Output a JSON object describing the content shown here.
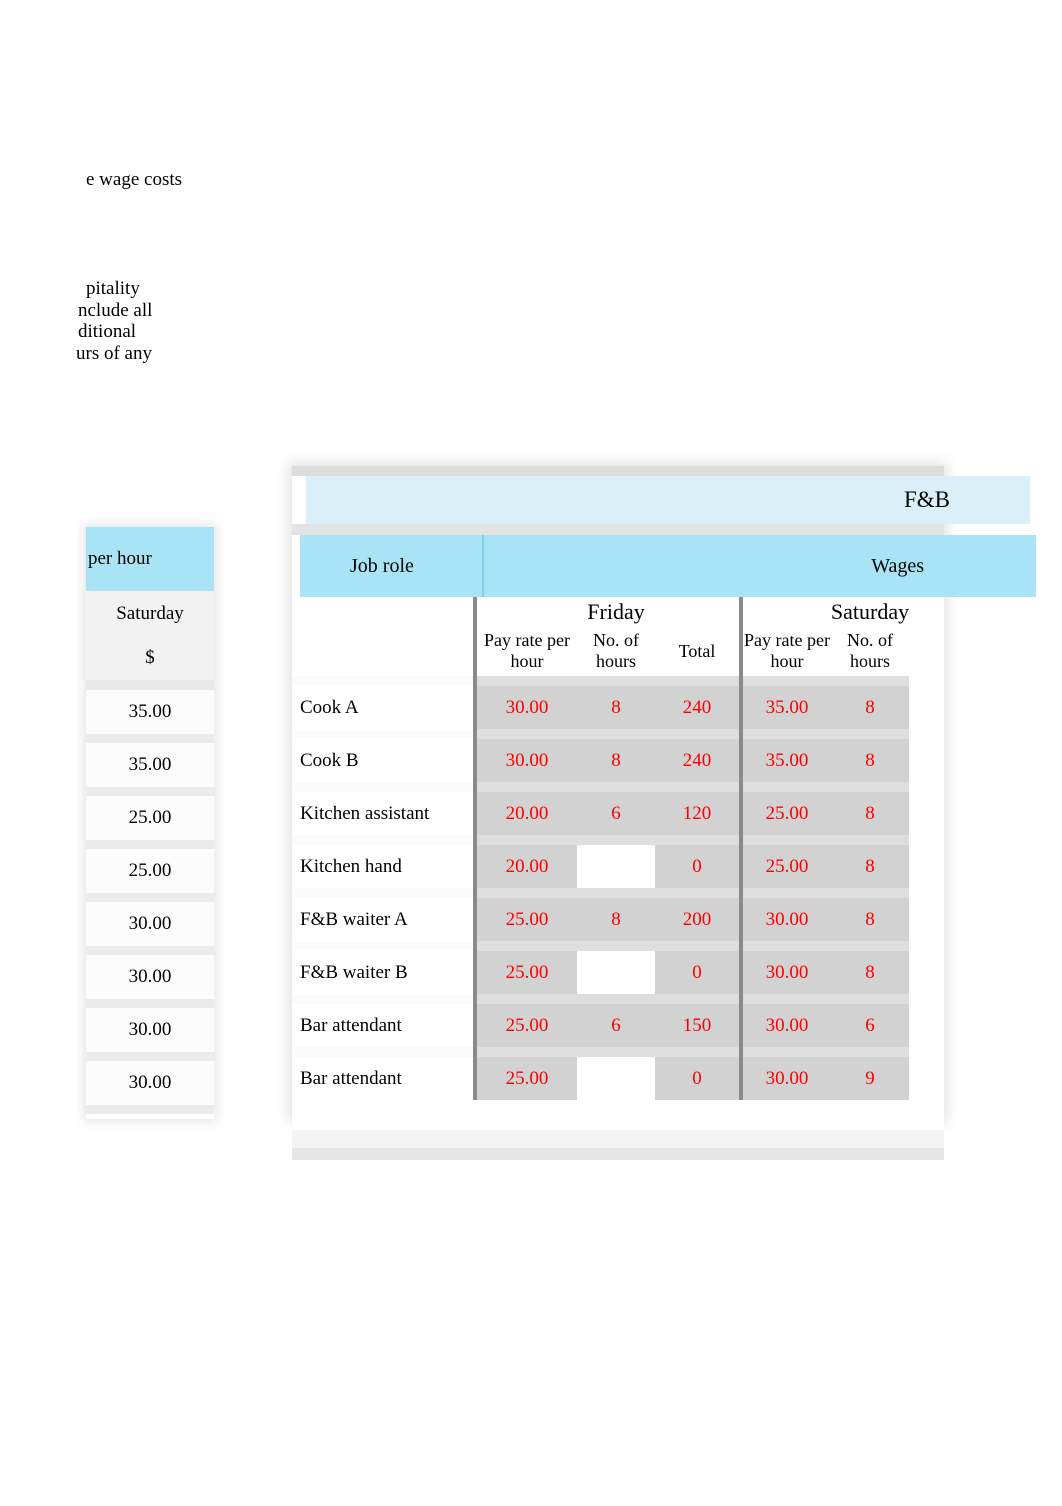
{
  "notes": {
    "title": "e wage costs",
    "line1": "pitality",
    "line2": "nclude all",
    "line3": "ditional",
    "line4": "urs of any"
  },
  "left_table": {
    "header": "per hour",
    "day": "Saturday",
    "currency": "$",
    "values": [
      "35.00",
      "35.00",
      "25.00",
      "25.00",
      "30.00",
      "30.00",
      "30.00",
      "30.00"
    ]
  },
  "main_table": {
    "title": "F&B",
    "group_header_left": "Job role",
    "group_header_right": "Wages",
    "day_friday": "Friday",
    "day_saturday": "Saturday",
    "columns": {
      "job_role": "",
      "friday_pay_rate": "Pay rate per hour",
      "friday_hours": "No. of hours",
      "friday_total": "Total",
      "saturday_pay_rate": "Pay rate per hour",
      "saturday_hours": "No. of hours"
    },
    "rows": [
      {
        "role": "Cook A",
        "fri_pay": "30.00",
        "fri_hours": "8",
        "fri_total": "240",
        "sat_pay": "35.00",
        "sat_hours": "8"
      },
      {
        "role": "Cook B",
        "fri_pay": "30.00",
        "fri_hours": "8",
        "fri_total": "240",
        "sat_pay": "35.00",
        "sat_hours": "8"
      },
      {
        "role": "Kitchen assistant",
        "fri_pay": "20.00",
        "fri_hours": "6",
        "fri_total": "120",
        "sat_pay": "25.00",
        "sat_hours": "8"
      },
      {
        "role": "Kitchen hand",
        "fri_pay": "20.00",
        "fri_hours": "",
        "fri_total": "0",
        "sat_pay": "25.00",
        "sat_hours": "8"
      },
      {
        "role": "F&B waiter A",
        "fri_pay": "25.00",
        "fri_hours": "8",
        "fri_total": "200",
        "sat_pay": "30.00",
        "sat_hours": "8"
      },
      {
        "role": "F&B waiter B",
        "fri_pay": "25.00",
        "fri_hours": "",
        "fri_total": "0",
        "sat_pay": "30.00",
        "sat_hours": "8"
      },
      {
        "role": "Bar attendant",
        "fri_pay": "25.00",
        "fri_hours": "6",
        "fri_total": "150",
        "sat_pay": "30.00",
        "sat_hours": "6"
      },
      {
        "role": "Bar attendant",
        "fri_pay": "25.00",
        "fri_hours": "",
        "fri_total": "0",
        "sat_pay": "30.00",
        "sat_hours": "9"
      }
    ]
  },
  "colors": {
    "header_blue_light": "#d9f0f9",
    "header_blue": "#a8e4f5",
    "cell_gray": "#d2d2d2",
    "value_red": "#ff0000"
  }
}
